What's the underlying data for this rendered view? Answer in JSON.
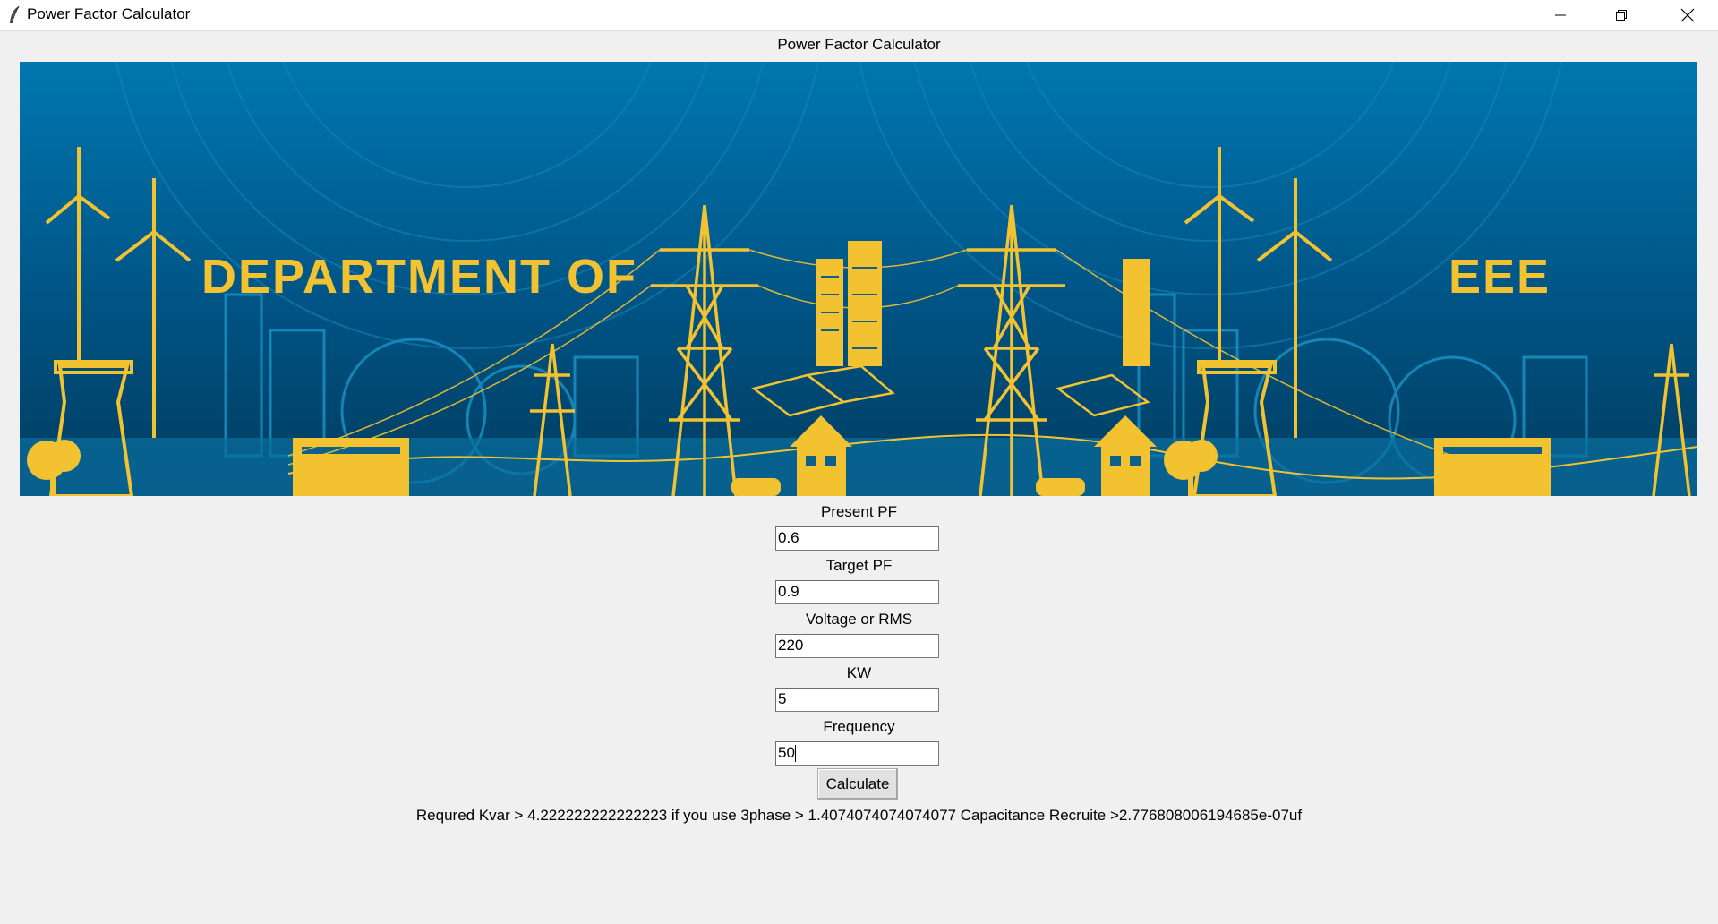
{
  "window": {
    "title": "Power Factor Calculator"
  },
  "app": {
    "heading": "Power Factor Calculator",
    "banner": {
      "left_text": "DEPARTMENT OF",
      "right_text": "EEE",
      "colors": {
        "sky_top": "#0075ad",
        "sky_bottom": "#003d63",
        "accent": "#f2c230",
        "line": "#1b94c6"
      }
    },
    "fields": [
      {
        "label": "Present PF",
        "value": "0.6"
      },
      {
        "label": "Target PF",
        "value": "0.9"
      },
      {
        "label": "Voltage or RMS",
        "value": "220"
      },
      {
        "label": "KW",
        "value": "5"
      },
      {
        "label": "Frequency",
        "value": "50"
      }
    ],
    "calculate_label": "Calculate",
    "result_text": "Requred Kvar > 4.222222222222223 if you use 3phase > 1.4074074074074077 Capacitance Recruite >2.776808006194685e-07uf"
  }
}
